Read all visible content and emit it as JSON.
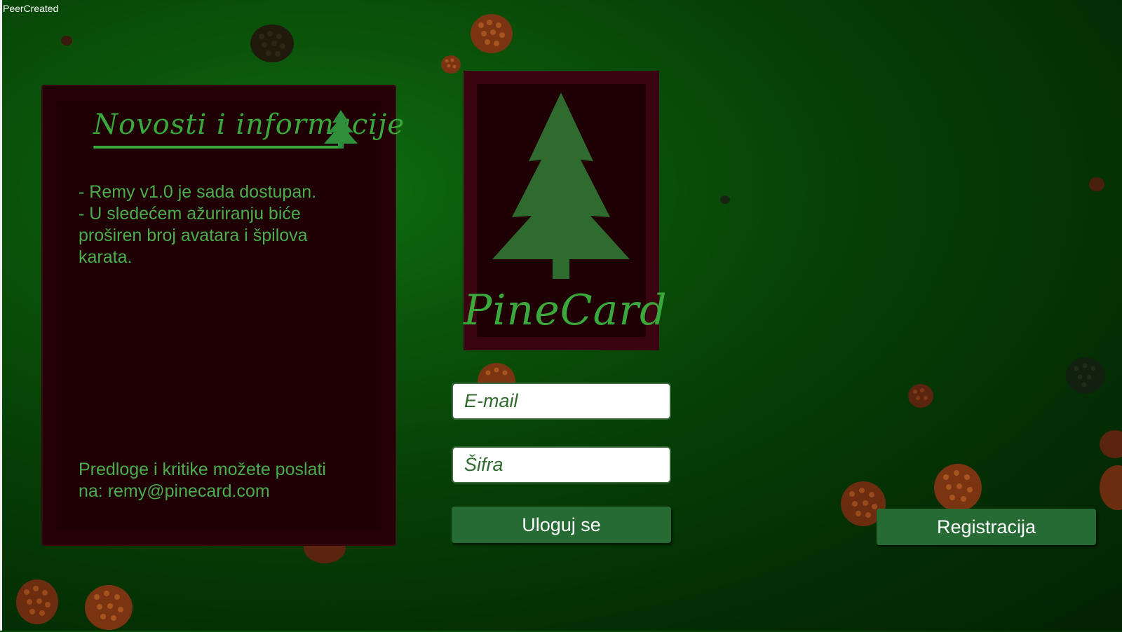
{
  "window": {
    "title": "PeerCreated"
  },
  "news": {
    "title": "Novosti i informacije",
    "body": "- Remy v1.0 je sada dostupan.\n- U sledećem ažuriranju biće\nproširen broj avatara i špilova\nkarata.",
    "footer": "Predloge i kritike možete poslati\nna: remy@pinecard.com"
  },
  "logo": {
    "text": "PineCard"
  },
  "login": {
    "email_placeholder": "E-mail",
    "password_placeholder": "Šifra",
    "login_label": "Uloguj se",
    "register_label": "Registracija"
  },
  "colors": {
    "accent": "#3aa83a",
    "button": "#256b33",
    "panel": "#240007",
    "frame": "#3a0410"
  },
  "icons": [
    "pine-tree-icon",
    "pinecone-icon"
  ]
}
